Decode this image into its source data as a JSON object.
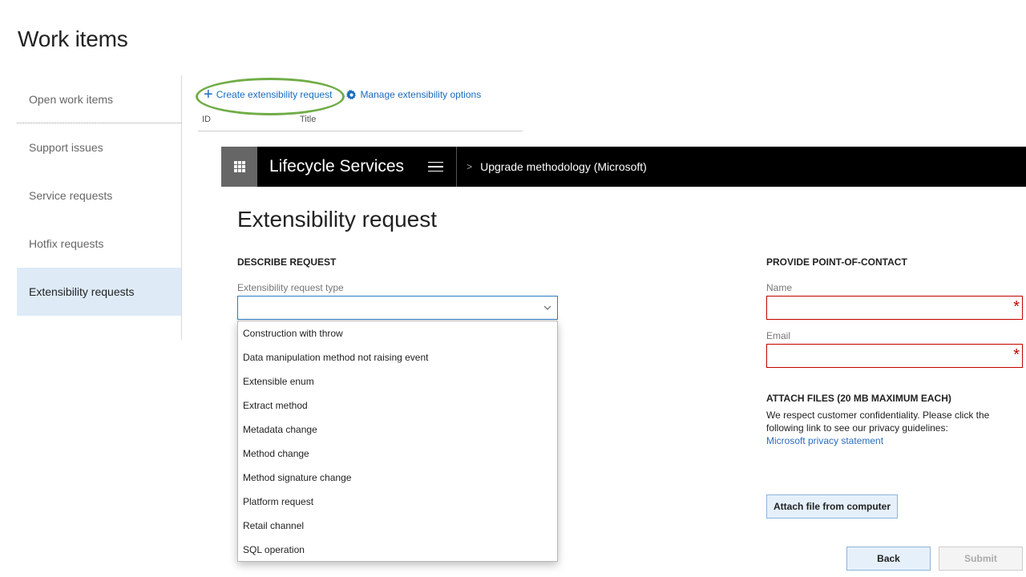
{
  "page": {
    "title": "Work items"
  },
  "sidebar": {
    "items": [
      {
        "label": "Open work items"
      },
      {
        "label": "Support issues"
      },
      {
        "label": "Service requests"
      },
      {
        "label": "Hotfix requests"
      },
      {
        "label": "Extensibility requests",
        "active": true
      }
    ]
  },
  "toolbar": {
    "create_label": "Create extensibility request",
    "manage_label": "Manage extensibility options"
  },
  "grid": {
    "columns": [
      "ID",
      "Title"
    ]
  },
  "lcs_header": {
    "brand": "Lifecycle Services",
    "breadcrumb_separator": ">",
    "breadcrumb": "Upgrade methodology (Microsoft)"
  },
  "form": {
    "title": "Extensibility request",
    "describe": {
      "heading": "DESCRIBE REQUEST",
      "type_label": "Extensibility request type",
      "type_value": "",
      "options": [
        "Construction with throw",
        "Data manipulation method not raising event",
        "Extensible enum",
        "Extract method",
        "Metadata change",
        "Method change",
        "Method signature change",
        "Platform request",
        "Retail channel",
        "SQL operation"
      ]
    },
    "contact": {
      "heading": "PROVIDE POINT-OF-CONTACT",
      "name_label": "Name",
      "name_value": "",
      "email_label": "Email",
      "email_value": "",
      "required_marker": "*"
    },
    "attach": {
      "heading": "ATTACH FILES (20 MB MAXIMUM EACH)",
      "text": "We respect customer confidentiality. Please click the following link to see our privacy guidelines:",
      "link": "Microsoft privacy statement",
      "attach_button": "Attach file from computer"
    },
    "buttons": {
      "back": "Back",
      "submit": "Submit"
    }
  },
  "colors": {
    "accent": "#1a6bbf",
    "highlight_ring": "#70ad47",
    "required": "#c00000",
    "active_nav": "#deebf7"
  }
}
